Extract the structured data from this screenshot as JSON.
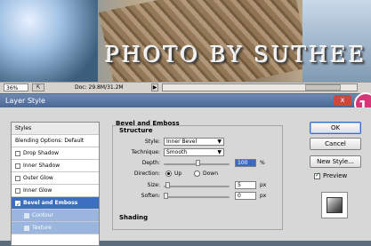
{
  "canvas": {
    "watermark": "PHOTO BY SUTHEE"
  },
  "status_bar": {
    "zoom": "36%",
    "doc_info": "Doc: 29.8M/31.2M"
  },
  "step_badge": "1",
  "dialog": {
    "title": "Layer Style",
    "close": "x"
  },
  "left_panel": {
    "items": [
      {
        "label": "Styles",
        "checkbox": false,
        "state": "header"
      },
      {
        "label": "Blending Options: Default",
        "checkbox": false,
        "state": "normal"
      },
      {
        "label": "Drop Shadow",
        "checkbox": true,
        "checked": false,
        "state": "normal"
      },
      {
        "label": "Inner Shadow",
        "checkbox": true,
        "checked": false,
        "state": "normal"
      },
      {
        "label": "Outer Glow",
        "checkbox": true,
        "checked": false,
        "state": "normal"
      },
      {
        "label": "Inner Glow",
        "checkbox": true,
        "checked": false,
        "state": "normal"
      },
      {
        "label": "Bevel and Emboss",
        "checkbox": true,
        "checked": true,
        "state": "selected"
      },
      {
        "label": "Contour",
        "checkbox": true,
        "checked": false,
        "state": "sub"
      },
      {
        "label": "Texture",
        "checkbox": true,
        "checked": false,
        "state": "sub"
      }
    ]
  },
  "bevel": {
    "title": "Bevel and Emboss",
    "structure_label": "Structure",
    "style_label": "Style:",
    "style_value": "Inner Bevel",
    "technique_label": "Technique:",
    "technique_value": "Smooth",
    "depth_label": "Depth:",
    "depth_value": "100",
    "depth_unit": "%",
    "direction_label": "Direction:",
    "direction_up": "Up",
    "direction_down": "Down",
    "direction_selected": "Up",
    "size_label": "Size:",
    "size_value": "5",
    "size_unit": "px",
    "soften_label": "Soften:",
    "soften_value": "0",
    "soften_unit": "px",
    "shading_label": "Shading"
  },
  "buttons": {
    "ok": "OK",
    "cancel": "Cancel",
    "new_style": "New Style...",
    "preview": "Preview",
    "preview_checked": true
  }
}
